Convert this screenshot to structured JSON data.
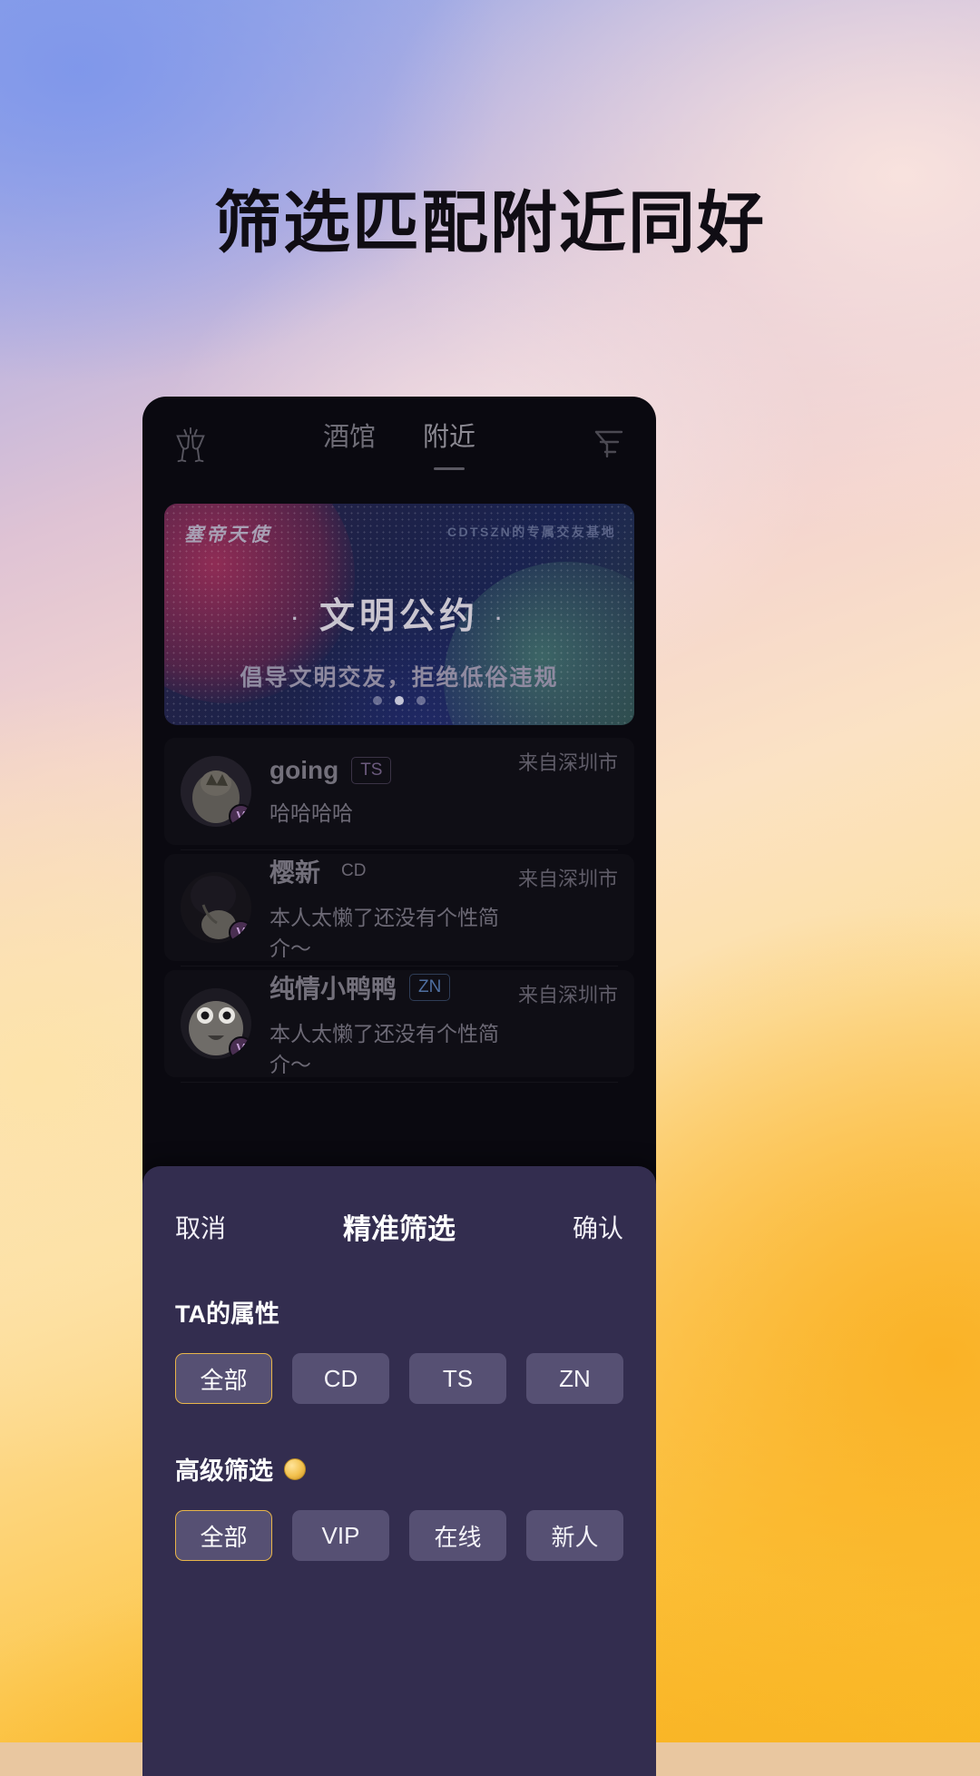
{
  "headline": "筛选匹配附近同好",
  "nav": {
    "logo_icon": "cheers-glasses-icon",
    "filter_icon": "funnel-icon",
    "tabs": [
      {
        "label": "酒馆",
        "active": false
      },
      {
        "label": "附近",
        "active": true
      }
    ]
  },
  "banner": {
    "brand": "塞帝天使",
    "corner": "CDTSZN的专属交友基地",
    "title": "文明公约",
    "dot": "·",
    "subtitle": "倡导文明交友，拒绝低俗违规",
    "pager": {
      "count": 3,
      "active_index": 1
    }
  },
  "list": {
    "rows": [
      {
        "name": "going",
        "tag": "TS",
        "tag_kind": "ts",
        "bio": "哈哈哈哈",
        "location": "来自深圳市",
        "verified_icon": "verified-badge-icon"
      },
      {
        "name": "樱新",
        "tag": "CD",
        "tag_kind": "cd",
        "bio": "本人太懒了还没有个性简介～",
        "location": "来自深圳市",
        "verified_icon": "verified-badge-icon"
      },
      {
        "name": "纯情小鸭鸭",
        "tag": "ZN",
        "tag_kind": "zn",
        "bio": "本人太懒了还没有个性简介～",
        "location": "来自深圳市",
        "verified_icon": "verified-badge-icon"
      }
    ]
  },
  "sheet": {
    "cancel": "取消",
    "title": "精准筛选",
    "confirm": "确认",
    "sections": [
      {
        "label": "TA的属性",
        "has_coin": false,
        "chips": [
          {
            "label": "全部",
            "selected": true
          },
          {
            "label": "CD",
            "selected": false
          },
          {
            "label": "TS",
            "selected": false
          },
          {
            "label": "ZN",
            "selected": false
          }
        ]
      },
      {
        "label": "高级筛选",
        "has_coin": true,
        "coin_icon": "gold-coin-icon",
        "chips": [
          {
            "label": "全部",
            "selected": true
          },
          {
            "label": "VIP",
            "selected": false
          },
          {
            "label": "在线",
            "selected": false
          },
          {
            "label": "新人",
            "selected": false
          }
        ]
      }
    ]
  },
  "colors": {
    "accent_gold": "#e8b54a",
    "sheet_bg": "#332d4f",
    "chip_bg": "#565073",
    "app_bg": "#0a0910"
  }
}
